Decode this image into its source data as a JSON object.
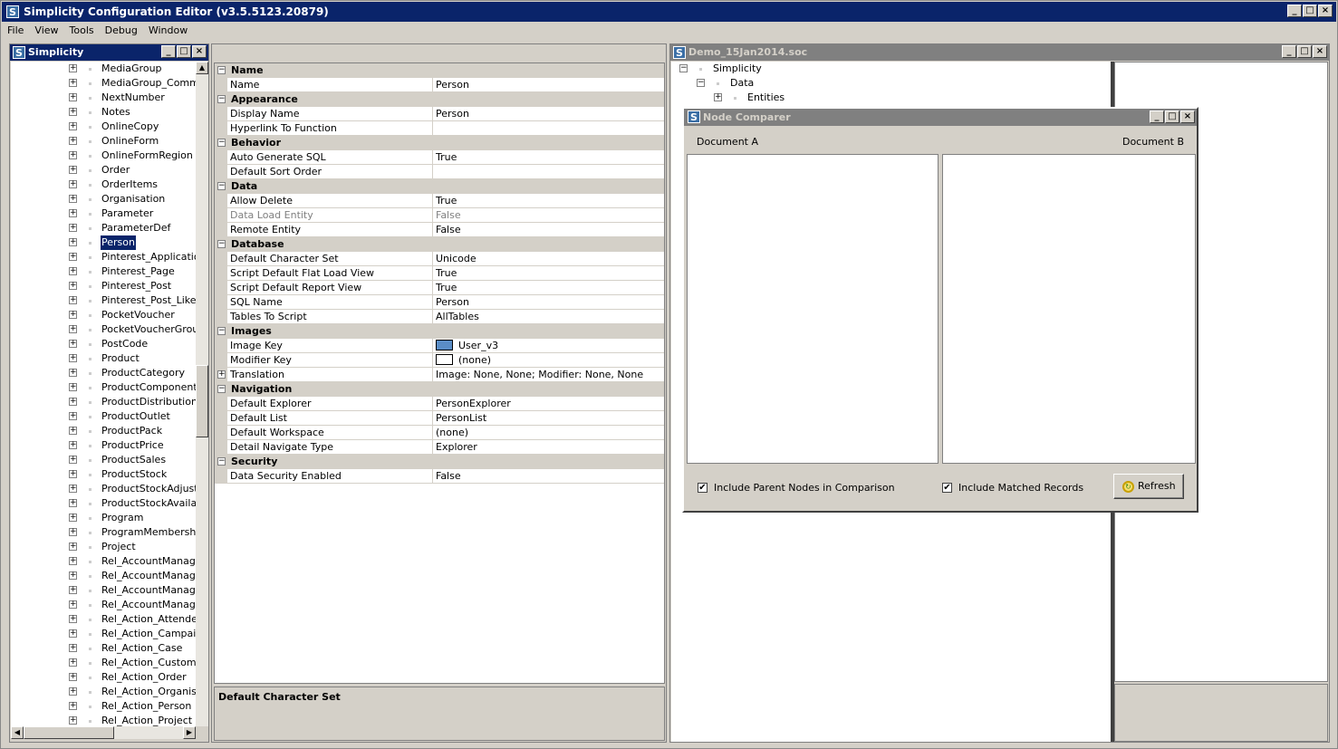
{
  "app": {
    "title": "Simplicity Configuration Editor (v3.5.5123.20879)",
    "icon_letter": "S"
  },
  "menu": [
    "File",
    "View",
    "Tools",
    "Debug",
    "Window"
  ],
  "left_panel": {
    "title": "Simplicity",
    "items": [
      {
        "label": "MediaGroup",
        "selected": false
      },
      {
        "label": "MediaGroup_Commur",
        "selected": false
      },
      {
        "label": "NextNumber",
        "selected": false
      },
      {
        "label": "Notes",
        "selected": false
      },
      {
        "label": "OnlineCopy",
        "selected": false
      },
      {
        "label": "OnlineForm",
        "selected": false
      },
      {
        "label": "OnlineFormRegion",
        "selected": false
      },
      {
        "label": "Order",
        "selected": false
      },
      {
        "label": "OrderItems",
        "selected": false
      },
      {
        "label": "Organisation",
        "selected": false
      },
      {
        "label": "Parameter",
        "selected": false
      },
      {
        "label": "ParameterDef",
        "selected": false
      },
      {
        "label": "Person",
        "selected": true
      },
      {
        "label": "Pinterest_Application",
        "selected": false
      },
      {
        "label": "Pinterest_Page",
        "selected": false
      },
      {
        "label": "Pinterest_Post",
        "selected": false
      },
      {
        "label": "Pinterest_Post_Like",
        "selected": false
      },
      {
        "label": "PocketVoucher",
        "selected": false
      },
      {
        "label": "PocketVoucherGroup",
        "selected": false
      },
      {
        "label": "PostCode",
        "selected": false
      },
      {
        "label": "Product",
        "selected": false
      },
      {
        "label": "ProductCategory",
        "selected": false
      },
      {
        "label": "ProductComponentGr",
        "selected": false
      },
      {
        "label": "ProductDistribution",
        "selected": false
      },
      {
        "label": "ProductOutlet",
        "selected": false
      },
      {
        "label": "ProductPack",
        "selected": false
      },
      {
        "label": "ProductPrice",
        "selected": false
      },
      {
        "label": "ProductSales",
        "selected": false
      },
      {
        "label": "ProductStock",
        "selected": false
      },
      {
        "label": "ProductStockAdjustm",
        "selected": false
      },
      {
        "label": "ProductStockAvailabi",
        "selected": false
      },
      {
        "label": "Program",
        "selected": false
      },
      {
        "label": "ProgramMembership",
        "selected": false
      },
      {
        "label": "Project",
        "selected": false
      },
      {
        "label": "Rel_AccountManager",
        "selected": false
      },
      {
        "label": "Rel_AccountManager",
        "selected": false
      },
      {
        "label": "Rel_AccountManager",
        "selected": false
      },
      {
        "label": "Rel_AccountManager",
        "selected": false
      },
      {
        "label": "Rel_Action_Attendee",
        "selected": false
      },
      {
        "label": "Rel_Action_Campaigr",
        "selected": false
      },
      {
        "label": "Rel_Action_Case",
        "selected": false
      },
      {
        "label": "Rel_Action_Customer",
        "selected": false
      },
      {
        "label": "Rel_Action_Order",
        "selected": false
      },
      {
        "label": "Rel_Action_Organisat",
        "selected": false
      },
      {
        "label": "Rel_Action_Person",
        "selected": false
      },
      {
        "label": "Rel_Action_Project",
        "selected": false
      }
    ]
  },
  "property_grid": {
    "categories": [
      {
        "name": "Name",
        "props": [
          {
            "name": "Name",
            "value": "Person"
          }
        ]
      },
      {
        "name": "Appearance",
        "props": [
          {
            "name": "Display Name",
            "value": "Person"
          },
          {
            "name": "Hyperlink To Function",
            "value": ""
          }
        ]
      },
      {
        "name": "Behavior",
        "props": [
          {
            "name": "Auto Generate SQL",
            "value": "True"
          },
          {
            "name": "Default Sort Order",
            "value": ""
          }
        ]
      },
      {
        "name": "Data",
        "props": [
          {
            "name": "Allow Delete",
            "value": "True"
          },
          {
            "name": "Data Load Entity",
            "value": "False",
            "disabled": true
          },
          {
            "name": "Remote Entity",
            "value": "False"
          }
        ]
      },
      {
        "name": "Database",
        "props": [
          {
            "name": "Default Character Set",
            "value": "Unicode"
          },
          {
            "name": "Script Default Flat Load View",
            "value": "True"
          },
          {
            "name": "Script Default Report View",
            "value": "True"
          },
          {
            "name": "SQL Name",
            "value": "Person"
          },
          {
            "name": "Tables To Script",
            "value": "AllTables"
          }
        ]
      },
      {
        "name": "Images",
        "props": [
          {
            "name": "Image Key",
            "value": "User_v3",
            "swatch": "user"
          },
          {
            "name": "Modifier Key",
            "value": "(none)",
            "swatch": "empty"
          },
          {
            "name": "Translation",
            "value": "Image: None, None; Modifier: None, None",
            "expandable": true
          }
        ]
      },
      {
        "name": "Navigation",
        "props": [
          {
            "name": "Default Explorer",
            "value": "PersonExplorer"
          },
          {
            "name": "Default List",
            "value": "PersonList"
          },
          {
            "name": "Default Workspace",
            "value": "(none)"
          },
          {
            "name": "Detail Navigate Type",
            "value": "Explorer"
          }
        ]
      },
      {
        "name": "Security",
        "props": [
          {
            "name": "Data Security Enabled",
            "value": "False"
          }
        ]
      }
    ],
    "description_title": "Default Character Set"
  },
  "doc_panel": {
    "title": "Demo_15Jan2014.soc",
    "tree": [
      {
        "label": "Simplicity",
        "toggle": "minus",
        "level": 0
      },
      {
        "label": "Data",
        "toggle": "minus",
        "level": 1
      },
      {
        "label": "Entities",
        "toggle": "plus",
        "level": 2
      }
    ]
  },
  "node_comparer": {
    "title": "Node Comparer",
    "doc_a_label": "Document A",
    "doc_b_label": "Document B",
    "include_parent_label": "Include Parent Nodes in Comparison",
    "include_parent_checked": true,
    "include_matched_label": "Include Matched Records",
    "include_matched_checked": true,
    "refresh_label": "Refresh"
  },
  "window_buttons": {
    "minimize": "_",
    "maximize": "□",
    "close": "×"
  }
}
